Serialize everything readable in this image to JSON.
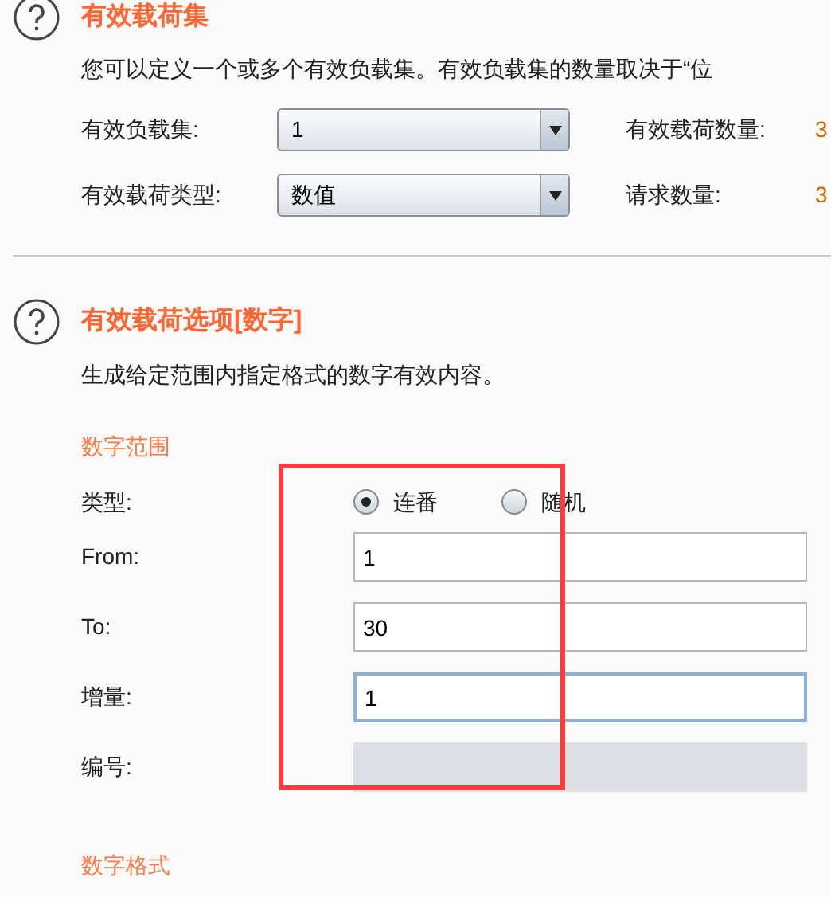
{
  "payload_sets": {
    "title": "有效载荷集",
    "description": "您可以定义一个或多个有效负载集。有效负载集的数量取决于“位",
    "fields": [
      {
        "label": "有效负载集:",
        "value": "1",
        "stat_label": "有效载荷数量:",
        "stat_value": "3"
      },
      {
        "label": "有效载荷类型:",
        "value": "数值",
        "stat_label": "请求数量:",
        "stat_value": "3"
      }
    ]
  },
  "payload_options": {
    "title": "有效载荷选项[数字]",
    "description": "生成给定范围内指定格式的数字有效内容。",
    "number_range": {
      "heading": "数字范围",
      "type_label": "类型:",
      "radios": [
        {
          "label": "连番",
          "selected": true
        },
        {
          "label": "随机",
          "selected": false
        }
      ],
      "inputs": [
        {
          "label": "From:",
          "value": "1",
          "focused": false,
          "disabled": false
        },
        {
          "label": "To:",
          "value": "30",
          "focused": false,
          "disabled": false
        },
        {
          "label": "增量:",
          "value": "1",
          "focused": true,
          "disabled": false
        },
        {
          "label": "编号:",
          "disabled": true
        }
      ]
    },
    "number_format": {
      "heading": "数字格式"
    }
  },
  "highlight": {
    "kind": "rectangle"
  }
}
